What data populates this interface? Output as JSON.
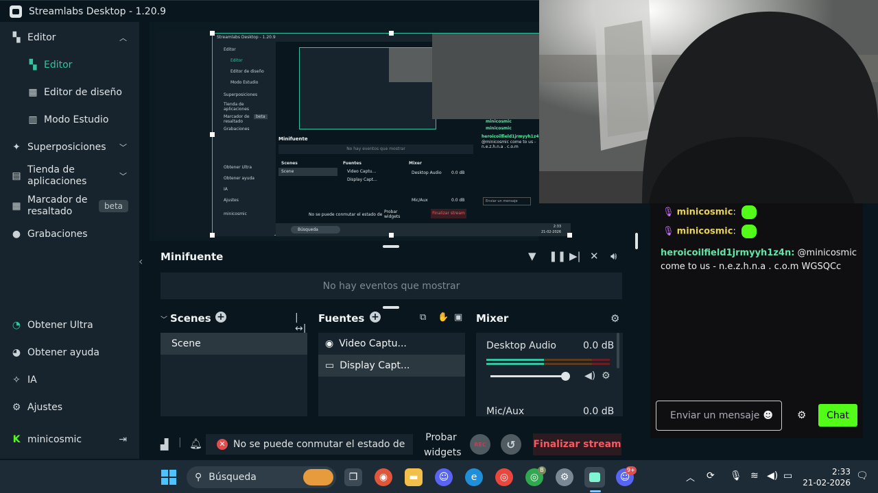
{
  "window": {
    "title": "Streamlabs Desktop - 1.20.9"
  },
  "sidebar": {
    "items": [
      {
        "label": "Editor"
      },
      {
        "label": "Editor"
      },
      {
        "label": "Editor de diseño"
      },
      {
        "label": "Modo Estudio"
      },
      {
        "label": "Superposiciones"
      },
      {
        "label": "Tienda de aplicaciones"
      },
      {
        "label": "Marcador de resaltado",
        "badge": "beta"
      },
      {
        "label": "Grabaciones"
      }
    ],
    "bottom": [
      {
        "label": "Obtener Ultra"
      },
      {
        "label": "Obtener ayuda"
      },
      {
        "label": "IA"
      },
      {
        "label": "Ajustes"
      }
    ],
    "user": "minicosmic"
  },
  "preview": {
    "mini_title": "Streamlabs Desktop - 1.20.9",
    "mini_items": [
      "Editor",
      "Editor",
      "Editor de diseño",
      "Modo Estudio",
      "Superposiciones",
      "Tienda de aplicaciones",
      "Marcador de resaltado",
      "Grabaciones",
      "Obtener Ultra",
      "Obtener ayuda",
      "IA",
      "Ajustes",
      "minicosmic"
    ],
    "mini_beta": "beta",
    "mini_minifuente": "Minifuente",
    "mini_no_events": "No hay eventos que mostrar",
    "mini_scenes": "Scenes",
    "mini_scene": "Scene",
    "mini_sources": "Fuentes",
    "mini_source_1": "Video Captu...",
    "mini_source_2": "Display Capt...",
    "mini_mixer": "Mixer",
    "mini_desktop_audio": "Desktop Audio",
    "mini_db": "0.0 dB",
    "mini_mic": "Mic/Aux",
    "mini_status": "No se puede conmutar el estado de",
    "mini_probar": "Probar widgets",
    "mini_end": "Finalizar stream",
    "mini_search": "Búsqueda",
    "mini_chat_user": "minicosmic",
    "mini_chat_user2": "heroicoilfield1jrmyyh1z4n:",
    "mini_chat_msg": "@minicosmic come to us - n.e.z.h.n.a . c.o.m",
    "mini_chat_placeholder": "Enviar un mensaje",
    "mini_time": "2:33",
    "mini_date": "21-02-2026"
  },
  "minifuente": {
    "title": "Minifuente",
    "empty": "No hay eventos que mostrar"
  },
  "scenes": {
    "title": "Scenes",
    "items": [
      "Scene"
    ]
  },
  "sources": {
    "title": "Fuentes",
    "items": [
      "Video Captu...",
      "Display Capt..."
    ]
  },
  "mixer": {
    "title": "Mixer",
    "channels": [
      {
        "name": "Desktop Audio",
        "db": "0.0 dB"
      },
      {
        "name": "Mic/Aux",
        "db": "0.0 dB"
      }
    ]
  },
  "footer": {
    "status": "No se puede conmutar el estado de",
    "probar": "Probar widgets",
    "rec": "REC",
    "end_stream": "Finalizar stream"
  },
  "chat": {
    "messages": [
      {
        "user": "minicosmic",
        "sep": ":"
      },
      {
        "user": "minicosmic",
        "sep": ":"
      },
      {
        "user": "heroicoilfield1jrmyyh1z4n:",
        "text": " @minicosmic",
        "text2": "come to us - n.e.z.h.n.a . c.o.m WGSQCc"
      }
    ],
    "input_placeholder": "Enviar un mensaje",
    "send_label": "Chat"
  },
  "taskbar": {
    "search": "Búsqueda",
    "time": "2:33",
    "date": "21-02-2026",
    "badge_b": "B",
    "badge_99": "9+"
  },
  "colors": {
    "accent": "#31c3a2",
    "end_stream": "#f85961",
    "chat_green": "#53fc18",
    "chat_user_green": "#63e4a8"
  }
}
